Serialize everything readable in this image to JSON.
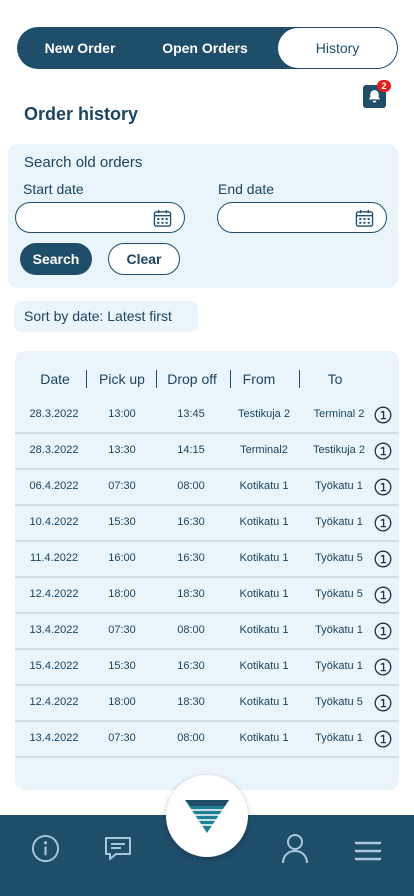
{
  "tabs": {
    "new_order": "New Order",
    "open_orders": "Open Orders",
    "history": "History"
  },
  "notifications": {
    "count": "2"
  },
  "page_title": "Order history",
  "search": {
    "title": "Search old orders",
    "start_label": "Start date",
    "end_label": "End date",
    "start_value": "",
    "end_value": "",
    "search_button": "Search",
    "clear_button": "Clear"
  },
  "sort": {
    "label": "Sort by date: Latest first"
  },
  "table": {
    "headers": [
      "Date",
      "Pick up",
      "Drop off",
      "From",
      "To"
    ],
    "rows": [
      [
        "28.3.2022",
        "13:00",
        "13:45",
        "Testikuja 2",
        "Terminal 2"
      ],
      [
        "28.3.2022",
        "13:30",
        "14:15",
        "Terminal2",
        "Testikuja 2"
      ],
      [
        "06.4.2022",
        "07:30",
        "08:00",
        "Kotikatu 1",
        "Työkatu 1"
      ],
      [
        "10.4.2022",
        "15:30",
        "16:30",
        "Kotikatu 1",
        "Työkatu 1"
      ],
      [
        "11.4.2022",
        "16:00",
        "16:30",
        "Kotikatu 1",
        "Työkatu 5"
      ],
      [
        "12.4.2022",
        "18:00",
        "18:30",
        "Kotikatu 1",
        "Työkatu 5"
      ],
      [
        "13.4.2022",
        "07:30",
        "08:00",
        "Kotikatu 1",
        "Työkatu 1"
      ],
      [
        "15.4.2022",
        "15:30",
        "16:30",
        "Kotikatu 1",
        "Työkatu 1"
      ],
      [
        "12.4.2022",
        "18:00",
        "18:30",
        "Kotikatu 1",
        "Työkatu 5"
      ],
      [
        "13.4.2022",
        "07:30",
        "08:00",
        "Kotikatu 1",
        "Työkatu 1"
      ]
    ]
  },
  "colors": {
    "primary": "#1f4e6b",
    "card_bg": "#eaf4fb",
    "badge": "#e02020"
  },
  "icons": {
    "bell": "bell-icon",
    "calendar": "calendar-icon",
    "row_info": "info-circle-icon",
    "nav_info": "info-icon",
    "nav_chat": "chat-icon",
    "nav_logo": "logo",
    "nav_profile": "user-icon",
    "nav_menu": "menu-icon"
  }
}
